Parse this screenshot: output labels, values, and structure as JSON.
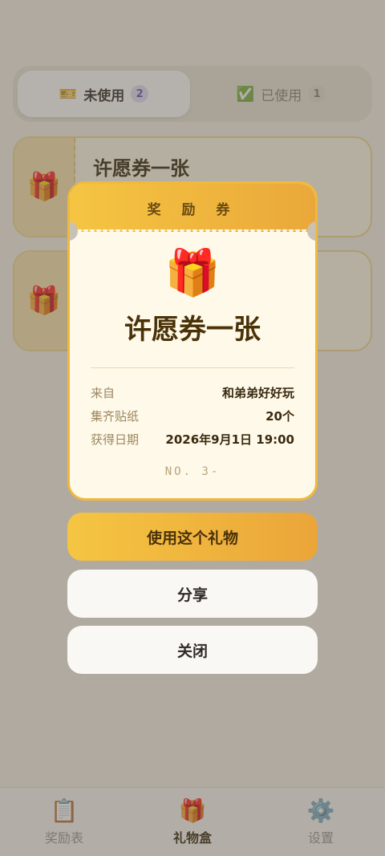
{
  "tabs": [
    {
      "icon": "🎫",
      "label": "未使用",
      "count": "2"
    },
    {
      "icon": "✅",
      "label": "已使用",
      "count": "1"
    }
  ],
  "list": [
    {
      "icon": "🎁",
      "title": "许愿券一张"
    },
    {
      "icon": "🎁",
      "title": ""
    }
  ],
  "modal": {
    "header": "奖 励 券",
    "icon": "🎁",
    "title": "许愿券一张",
    "rows": [
      {
        "label": "来自",
        "value": "和弟弟好好玩"
      },
      {
        "label": "集齐贴纸",
        "value": "20个"
      },
      {
        "label": "获得日期",
        "value": "2026年9月1日 19:00"
      }
    ],
    "serial": "NO. 3-"
  },
  "actions": {
    "use": "使用这个礼物",
    "share": "分享",
    "close": "关闭"
  },
  "nav": [
    {
      "icon": "📋",
      "label": "奖励表"
    },
    {
      "icon": "🎁",
      "label": "礼物盒"
    },
    {
      "icon": "⚙️",
      "label": "设置"
    }
  ]
}
